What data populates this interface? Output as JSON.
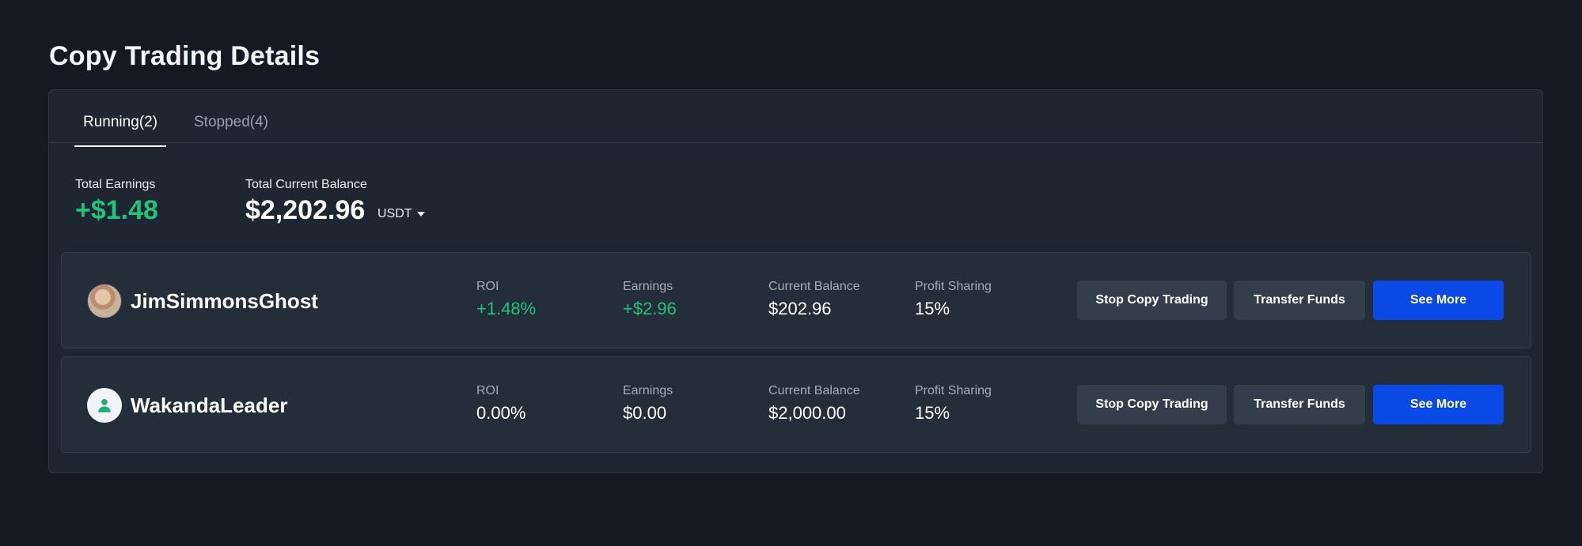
{
  "page": {
    "title": "Copy Trading Details"
  },
  "tabs": [
    {
      "label": "Running(2)",
      "active": true
    },
    {
      "label": "Stopped(4)",
      "active": false
    }
  ],
  "summary": {
    "total_earnings_label": "Total Earnings",
    "total_earnings_value": "+$1.48",
    "total_balance_label": "Total Current Balance",
    "total_balance_value": "$2,202.96",
    "currency": "USDT"
  },
  "labels": {
    "roi": "ROI",
    "earnings": "Earnings",
    "current_balance": "Current Balance",
    "profit_sharing": "Profit Sharing",
    "stop_button": "Stop Copy Trading",
    "transfer_button": "Transfer Funds",
    "see_more_button": "See More"
  },
  "traders": [
    {
      "name": "JimSimmonsGhost",
      "avatar": "photo-avatar",
      "roi": "+1.48%",
      "earnings": "+$2.96",
      "current_balance": "$202.96",
      "profit_sharing": "15%"
    },
    {
      "name": "WakandaLeader",
      "avatar": "user-icon",
      "roi": "0.00%",
      "earnings": "$0.00",
      "current_balance": "$2,000.00",
      "profit_sharing": "15%"
    }
  ],
  "colors": {
    "background": "#131a24",
    "panel": "#1e2632",
    "row": "#242d3a",
    "positive": "#22c37a",
    "primary_button": "#0b49e6",
    "secondary_button": "#333d4c",
    "user_icon": "#19b07a"
  }
}
